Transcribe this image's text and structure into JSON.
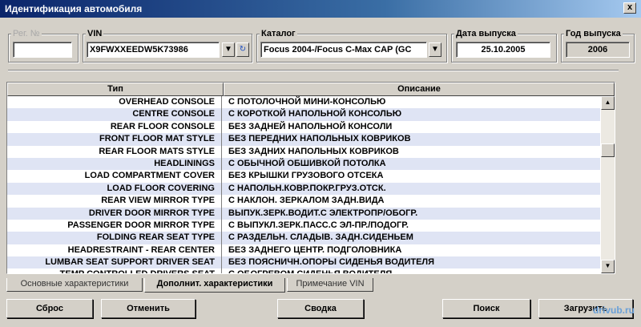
{
  "window": {
    "title": "Идентификация автомобиля",
    "close_glyph": "x"
  },
  "fields": {
    "reg_label": "Рег. №",
    "reg_value": "",
    "vin_label": "VIN",
    "vin_value": "X9FWXXEEDW5K73986",
    "catalog_label": "Каталог",
    "catalog_value": "Focus 2004-/Focus C-Max CAP (GC",
    "release_date_label": "Дата выпуска",
    "release_date_value": "25.10.2005",
    "release_year_label": "Год выпуска",
    "release_year_value": "2006"
  },
  "table": {
    "columns": [
      "Тип",
      "Описание"
    ],
    "rows": [
      [
        "OVERHEAD CONSOLE",
        "С ПОТОЛОЧНОЙ МИНИ-КОНСОЛЬЮ"
      ],
      [
        "CENTRE CONSOLE",
        "С КОРОТКОЙ НАПОЛЬНОЙ КОНСОЛЬЮ"
      ],
      [
        "REAR FLOOR CONSOLE",
        "БЕЗ ЗАДНЕЙ НАПОЛЬНОЙ КОНСОЛИ"
      ],
      [
        "FRONT FLOOR MAT STYLE",
        "БЕЗ ПЕРЕДНИХ НАПОЛЬНЫХ КОВРИКОВ"
      ],
      [
        "REAR FLOOR MATS STYLE",
        "БЕЗ ЗАДНИХ НАПОЛЬНЫХ КОВРИКОВ"
      ],
      [
        "HEADLININGS",
        "С ОБЫЧНОЙ ОБШИВКОЙ ПОТОЛКА"
      ],
      [
        "LOAD COMPARTMENT COVER",
        "БЕЗ КРЫШКИ ГРУЗОВОГО ОТСЕКА"
      ],
      [
        "LOAD FLOOR COVERING",
        "С НАПОЛЬН.КОВР.ПОКР.ГРУЗ.ОТСК."
      ],
      [
        "REAR VIEW MIRROR TYPE",
        "С НАКЛОН. ЗЕРКАЛОМ ЗАДН.ВИДА"
      ],
      [
        "DRIVER DOOR MIRROR TYPE",
        "ВЫПУК.ЗЕРК.ВОДИТ.С ЭЛЕКТРОПР/ОБОГР."
      ],
      [
        "PASSENGER DOOR MIRROR TYPE",
        "С ВЫПУКЛ.ЗЕРК.ПАСС.С ЭЛ-ПР./ПОДОГР."
      ],
      [
        "FOLDING REAR SEAT TYPE",
        "С РАЗДЕЛЬН. СЛАДЫВ. ЗАДН.СИДЕНЬЕМ"
      ],
      [
        "HEADRESTRAINT - REAR CENTER",
        "БЕЗ ЗАДНЕГО ЦЕНТР. ПОДГОЛОВНИКА"
      ],
      [
        "LUMBAR SEAT SUPPORT DRIVER SEAT",
        "БЕЗ ПОЯСНИЧН.ОПОРЫ СИДЕНЬЯ ВОДИТЕЛЯ"
      ],
      [
        "TEMP CONTROLLED DRIVERS SEAT",
        "С ОБОГРЕВОМ СИДЕНЬЯ ВОДИТЕЛЯ"
      ]
    ]
  },
  "tabs": [
    "Основные характеристики",
    "Дополнит. характеристики",
    "Примечание VIN"
  ],
  "active_tab": 1,
  "buttons": {
    "reset": "Сброс",
    "cancel": "Отменить",
    "summary": "Сводка",
    "search": "Поиск",
    "load": "Загрузить"
  },
  "watermark": "drivub.ru",
  "icons": {
    "dropdown": "dropdown-arrow-icon",
    "refresh": "refresh-icon",
    "scroll_up": "scroll-up-icon",
    "scroll_down": "scroll-down-icon"
  },
  "colors": {
    "alt_row": "#dfe4f4",
    "titlebar": "#0a246a"
  }
}
